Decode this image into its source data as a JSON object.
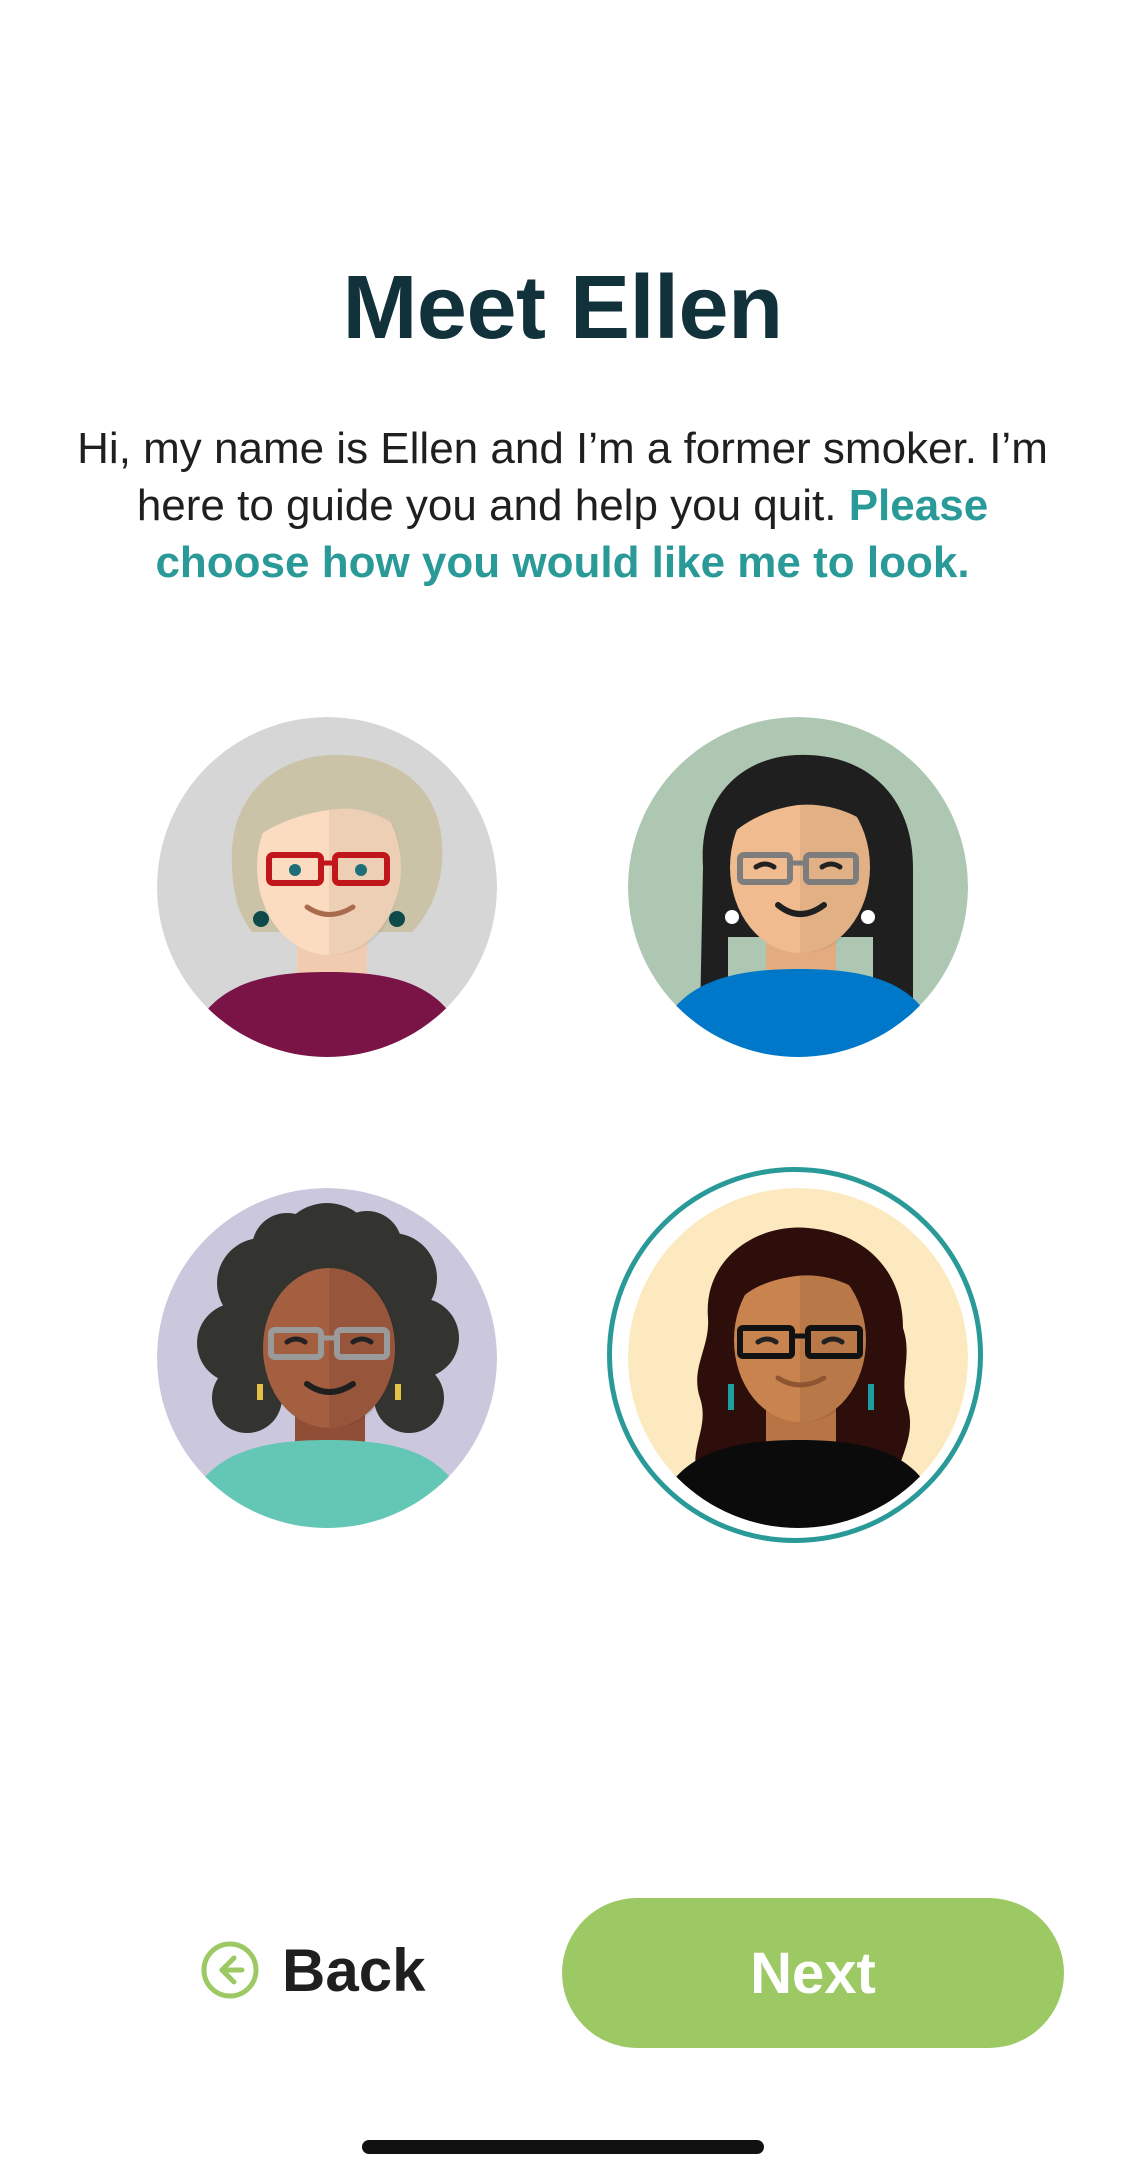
{
  "header": {
    "title": "Meet Ellen"
  },
  "intro": {
    "text_plain": "Hi, my name is Ellen and I’m a former smoker. I’m here to guide you and help you quit. ",
    "text_emphasis": "Please choose how you would like me to look."
  },
  "avatars": {
    "selected_index": 4,
    "items": [
      {
        "icon": "avatar-older-light-skin-icon",
        "background": "#d6d6d6"
      },
      {
        "icon": "avatar-long-black-hair-icon",
        "background": "#adc7b2"
      },
      {
        "icon": "avatar-curly-hair-icon",
        "background": "#cbc8de"
      },
      {
        "icon": "avatar-wavy-hair-icon",
        "background": "#fde9bf"
      }
    ]
  },
  "footer": {
    "back_label": "Back",
    "back_icon": "arrow-left-circle-icon",
    "next_label": "Next"
  },
  "colors": {
    "title": "#11323b",
    "accent": "#2a9a99",
    "next_button": "#9cc963",
    "back_icon": "#9cc963"
  }
}
